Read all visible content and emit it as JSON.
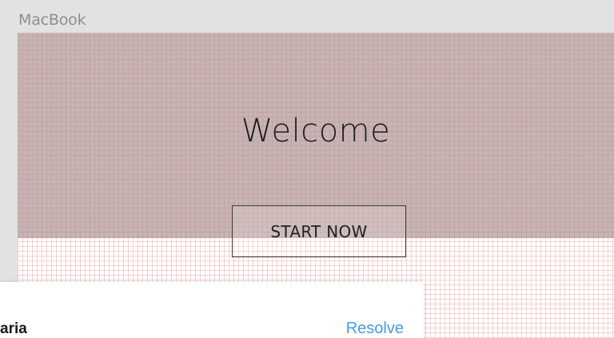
{
  "artboard": {
    "label": "MacBook"
  },
  "hero": {
    "heading": "Welcome",
    "cta_label": "START NOW"
  },
  "comment": {
    "author_partial": "aria",
    "resolve_label": "Resolve"
  },
  "colors": {
    "workspace_bg": "#e2e2e2",
    "hero_bg": "#c2b6b6",
    "grid_line": "#e87878",
    "resolve_link": "#4a9be8"
  }
}
